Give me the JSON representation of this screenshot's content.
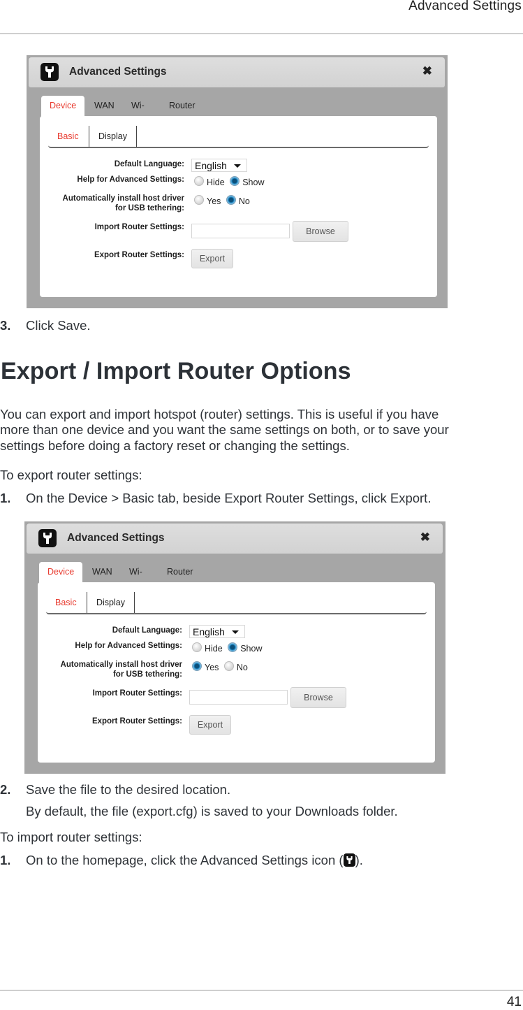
{
  "header": {
    "running_title": "Advanced Settings"
  },
  "icons": {
    "app_icon": "wrench-icon",
    "close_icon": "close-icon",
    "dropdown_icon": "caret-down-icon"
  },
  "colors": {
    "active_tab": "#e8392d",
    "radio_selected": "#1f8ac7",
    "dialog_frame": "#a6a6a6"
  },
  "screenshots": [
    {
      "title": "Advanced Settings",
      "close_glyph": "✖",
      "tabs": [
        "Device",
        "WAN",
        "Wi-Fi",
        "Router"
      ],
      "active_tab": "Device",
      "subtabs": [
        "Basic",
        "Display"
      ],
      "active_subtab": "Basic",
      "fields": {
        "default_language": {
          "label": "Default Language:",
          "value": "English"
        },
        "help": {
          "label": "Help for Advanced Settings:",
          "options": [
            "Hide",
            "Show"
          ],
          "selected": "Show"
        },
        "usb": {
          "label_line1": "Automatically install host driver",
          "label_line2": "for USB tethering:",
          "options": [
            "Yes",
            "No"
          ],
          "selected": "No"
        },
        "import": {
          "label": "Import Router Settings:",
          "value": "",
          "button": "Browse"
        },
        "export": {
          "label": "Export Router Settings:",
          "button": "Export"
        }
      }
    },
    {
      "title": "Advanced Settings",
      "close_glyph": "✖",
      "tabs": [
        "Device",
        "WAN",
        "Wi-Fi",
        "Router"
      ],
      "active_tab": "Device",
      "subtabs": [
        "Basic",
        "Display"
      ],
      "active_subtab": "Basic",
      "fields": {
        "default_language": {
          "label": "Default Language:",
          "value": "English"
        },
        "help": {
          "label": "Help for Advanced Settings:",
          "options": [
            "Hide",
            "Show"
          ],
          "selected": "Show"
        },
        "usb": {
          "label_line1": "Automatically install host driver",
          "label_line2": "for USB tethering:",
          "options": [
            "Yes",
            "No"
          ],
          "selected": "Yes"
        },
        "import": {
          "label": "Import Router Settings:",
          "value": "",
          "button": "Browse"
        },
        "export": {
          "label": "Export Router Settings:",
          "button": "Export"
        }
      }
    }
  ],
  "content": {
    "step_save": {
      "num": "3.",
      "text": "Click Save."
    },
    "heading": "Export / Import Router Options",
    "intro_lines": [
      "You can export and import hotspot (router) settings. This is useful if you have",
      "more than one device and you want the same settings on both, or to save your",
      "settings before doing a factory reset or changing the settings."
    ],
    "export_intro": "To export router settings:",
    "export_step1": {
      "num": "1.",
      "text": "On the Device > Basic tab, beside Export Router Settings, click Export."
    },
    "export_step2": {
      "num": "2.",
      "text": "Save the file to the desired location."
    },
    "export_note": "By default, the file (export.cfg) is saved to your Downloads folder.",
    "import_intro": "To import router settings:",
    "import_step1": {
      "num": "1.",
      "text_before": "On to the homepage, click the Advanced Settings icon (",
      "text_after": ")."
    }
  },
  "footer": {
    "page_number": "41"
  }
}
